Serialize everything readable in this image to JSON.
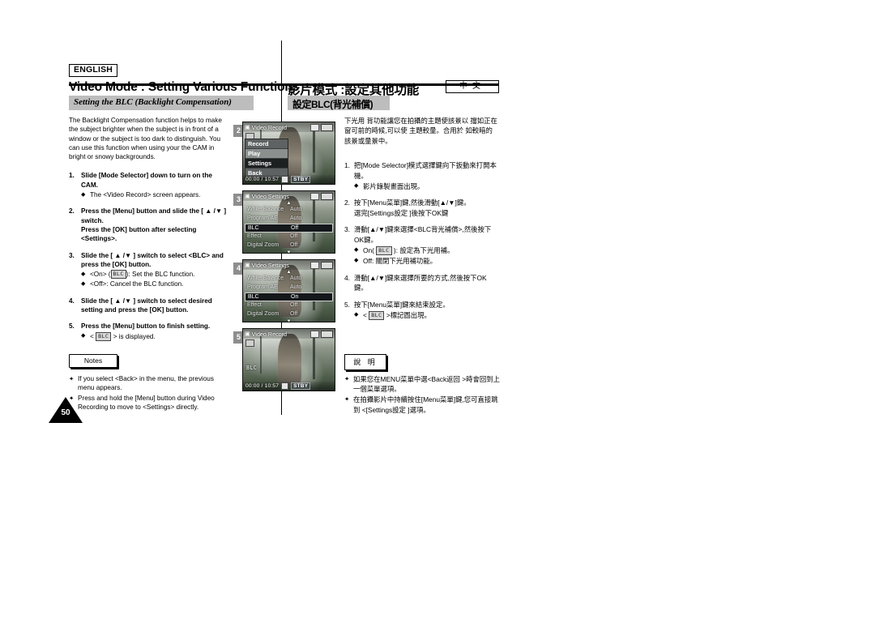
{
  "header": {
    "language_chip": "ENGLISH",
    "title_en": "Video Mode : Setting Various Functions",
    "title_zh": "影片模式 :設定其他功能",
    "language_chip_zh": "中文"
  },
  "section": {
    "band_en": "Setting the BLC (Backlight Compensation)",
    "band_zh": "設定BLC(背光補償)"
  },
  "english": {
    "intro": "The Backlight Compensation function helps to make the subject brighter when the subject is in front of a window or the subject is too dark to distinguish. You can use this function when using your the CAM in bright or snowy backgrounds.",
    "steps": [
      {
        "num": "1.",
        "text": "Slide [Mode Selector] down to turn on the CAM.",
        "bullets": [
          {
            "marker": "◆",
            "text": "The <Video Record> screen appears."
          }
        ]
      },
      {
        "num": "2.",
        "text": "Press the [Menu] button and slide the [ ▲ /▼ ] switch.",
        "text2": "Press the [OK] button after selecting <Settings>.",
        "bullets": []
      },
      {
        "num": "3.",
        "text": "Slide the [ ▲ /▼ ] switch to select <BLC> and press the [OK] button.",
        "bullets": [
          {
            "marker": "◆",
            "pre": "<On> (",
            "glyph": "BLC",
            "post": "): Set the BLC function."
          },
          {
            "marker": "◆",
            "text": "<Off>: Cancel the BLC function."
          }
        ]
      },
      {
        "num": "4.",
        "text": "Slide the [ ▲ /▼ ] switch to select desired setting and press the [OK] button.",
        "bullets": []
      },
      {
        "num": "5.",
        "text": "Press the [Menu] button to finish setting.",
        "bullets": [
          {
            "marker": "◆",
            "pre": "< ",
            "glyph": "BLC",
            "post": " > is displayed."
          }
        ]
      }
    ],
    "notes_label": "Notes",
    "notes": [
      {
        "marker": "✦",
        "text": "If you select <Back> in the menu, the previous menu appears."
      },
      {
        "marker": "✦",
        "text": "Press and hold the [Menu] button during Video Recording to move to <Settings> directly."
      }
    ]
  },
  "chinese": {
    "intro": "下光用 背功能讓您在拍攝的主題使該景以 擋如正在窗可前的時候,可以使 主題較量。合用於 如較暗的該景或量景中。",
    "steps": [
      {
        "num": "1.",
        "text": "把[Mode Selector]模式選擇鍵向下扳動來打開本機。",
        "bullets": [
          {
            "marker": "◆",
            "text": "影片錄製畫面出現。"
          }
        ]
      },
      {
        "num": "2.",
        "text": "按下[Menu菜單]鍵,然後滑動[▲/▼]鍵。",
        "text2": "選完[Settings設定 ]後按下OK鍵",
        "bullets": []
      },
      {
        "num": "3.",
        "text": "滑動[▲/▼]鍵來選擇<BLC背光補償>,然後按下OK鍵。",
        "bullets": [
          {
            "marker": "◆",
            "pre": "On( ",
            "glyph": "BLC",
            "post": " ): 設定為下光用補。"
          },
          {
            "marker": "◆",
            "text": "Off: 關閉下光用補功能。"
          }
        ]
      },
      {
        "num": "4.",
        "text": "滑動[▲/▼]鍵來選擇所要的方式,然後按下OK鍵。",
        "bullets": []
      },
      {
        "num": "5.",
        "text": "按下[Menu菜單]鍵來結束設定。",
        "bullets": [
          {
            "marker": "◆",
            "pre": "< ",
            "glyph": "BLC",
            "post": " >標記圖出現。"
          }
        ]
      }
    ],
    "notes_label": "說 明",
    "notes": [
      {
        "marker": "✦",
        "text": "如果您在MENU菜單中選<Back返回 >時會回到上一個菜單選項。"
      },
      {
        "marker": "✦",
        "text": "在拍攝影片中持續按住[Menu菜單]鍵,您可直接跳到 <[Settings設定 ]選項。"
      }
    ]
  },
  "figures": [
    {
      "badge": "2",
      "kind": "record-menu",
      "osd": {
        "mode_label": "Video Record",
        "timecode": "00:00 / 10:57",
        "status": "STBY"
      },
      "menu_items": [
        {
          "label": "Record",
          "state": "normal"
        },
        {
          "label": "Play",
          "state": "normal"
        },
        {
          "label": "Settings",
          "state": "selected"
        },
        {
          "label": "Back",
          "state": "normal"
        }
      ]
    },
    {
      "badge": "3",
      "kind": "settings",
      "osd": {
        "mode_label": "Video Settings"
      },
      "rows": [
        {
          "key": "White Balance",
          "value": "Auto",
          "state": "normal"
        },
        {
          "key": "Program AE",
          "value": "Auto",
          "state": "normal"
        },
        {
          "key": "BLC",
          "value": "Off",
          "state": "selected"
        },
        {
          "key": "Effect",
          "value": "Off",
          "state": "normal"
        },
        {
          "key": "Digital Zoom",
          "value": "Off",
          "state": "normal"
        }
      ]
    },
    {
      "badge": "4",
      "kind": "settings",
      "osd": {
        "mode_label": "Video Settings"
      },
      "rows": [
        {
          "key": "White Balance",
          "value": "Auto",
          "state": "normal"
        },
        {
          "key": "Program AE",
          "value": "Auto",
          "state": "normal"
        },
        {
          "key": "BLC",
          "value": "On",
          "state": "selected"
        },
        {
          "key": "Effect",
          "value": "Off",
          "state": "normal"
        },
        {
          "key": "Digital Zoom",
          "value": "Off",
          "state": "normal"
        }
      ]
    },
    {
      "badge": "5",
      "kind": "record-blc",
      "osd": {
        "mode_label": "Video Record",
        "timecode": "00:00 / 10:57",
        "status": "STBY",
        "blc_indicator": "BLC"
      }
    }
  ],
  "page": {
    "number": "50"
  },
  "colors": {
    "band": "#bdbdbd",
    "badge": "#8e8e8e",
    "rule": "#000000"
  }
}
